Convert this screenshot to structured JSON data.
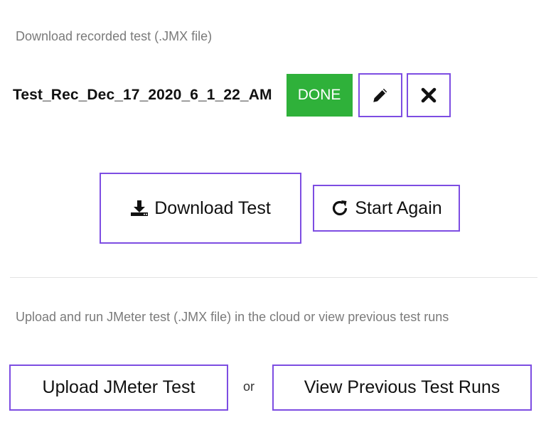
{
  "download_section": {
    "description": "Download recorded test (.JMX file)",
    "test_name": "Test_Rec_Dec_17_2020_6_1_22_AM",
    "status_badge": "DONE",
    "download_label": "Download Test",
    "start_again_label": "Start Again"
  },
  "upload_section": {
    "description": "Upload and run JMeter test (.JMX file) in the cloud or view previous test runs",
    "upload_label": "Upload JMeter Test",
    "or_label": "or",
    "view_runs_label": "View Previous Test Runs"
  },
  "icons": {
    "edit": "pencil-icon",
    "delete": "close-icon",
    "download": "download-icon",
    "restart": "refresh-icon"
  },
  "colors": {
    "accent_border": "#7d4de2",
    "done_green": "#2fb13a",
    "muted_text": "#7a7a7a"
  }
}
